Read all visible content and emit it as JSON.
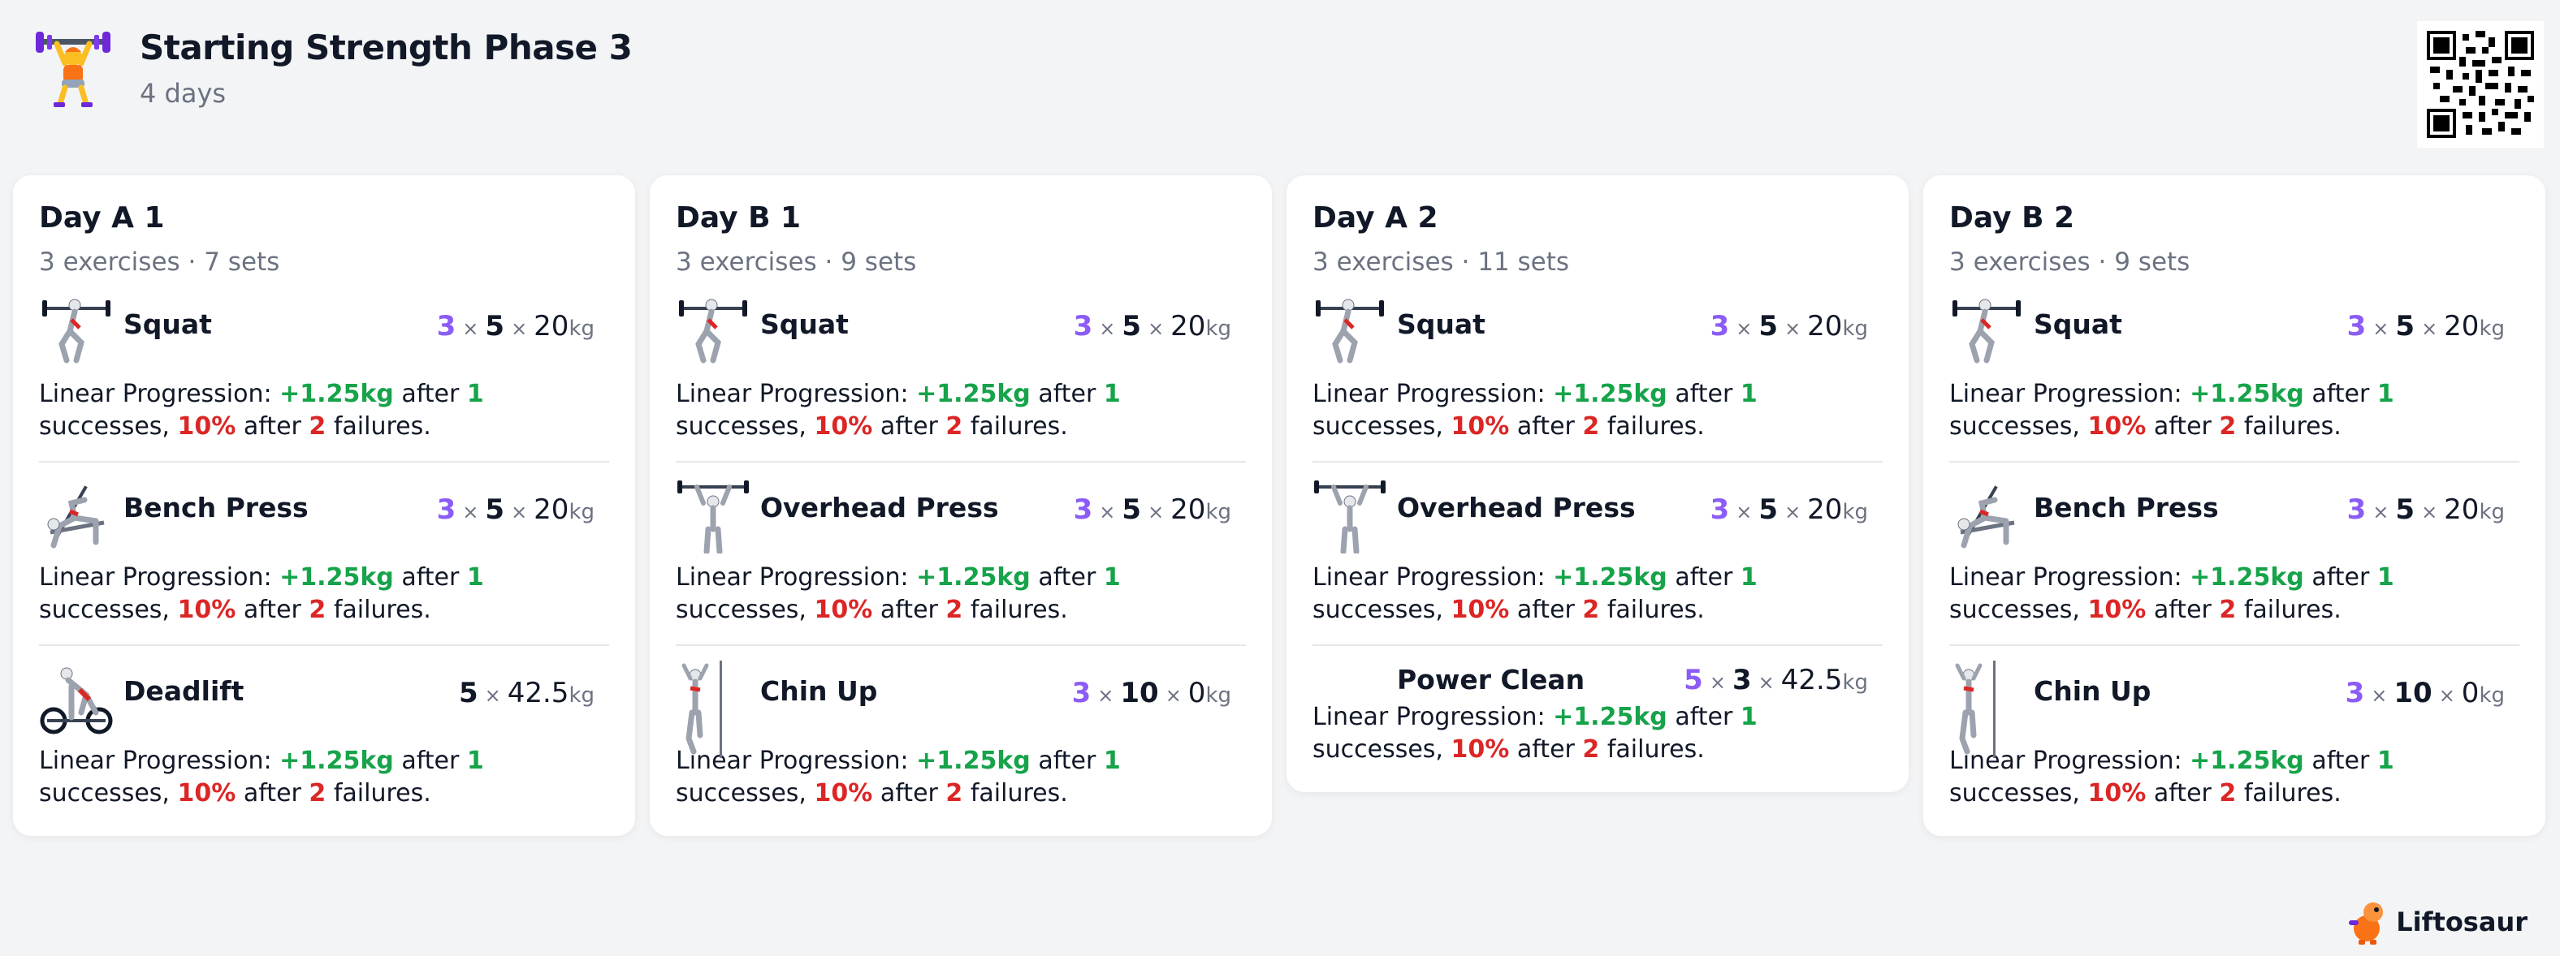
{
  "header": {
    "title": "Starting Strength Phase 3",
    "subtitle": "4 days"
  },
  "days": [
    {
      "title": "Day A 1",
      "meta": "3 exercises · 7 sets",
      "exercises": [
        {
          "name": "Squat",
          "sets": "3",
          "reps": "5",
          "weight": "20",
          "unit": "kg",
          "icon": "squat-icon",
          "prog": {
            "label": "Linear Progression:",
            "inc": "+1.25kg",
            "after1": "after",
            "succ": "1",
            "succ_word": "successes,",
            "dec": "10%",
            "after2": "after",
            "fail": "2",
            "fail_word": "failures."
          }
        },
        {
          "name": "Bench Press",
          "sets": "3",
          "reps": "5",
          "weight": "20",
          "unit": "kg",
          "icon": "bench-press-icon",
          "prog": {
            "label": "Linear Progression:",
            "inc": "+1.25kg",
            "after1": "after",
            "succ": "1",
            "succ_word": "successes,",
            "dec": "10%",
            "after2": "after",
            "fail": "2",
            "fail_word": "failures."
          }
        },
        {
          "name": "Deadlift",
          "sets": "",
          "reps": "5",
          "weight": "42.5",
          "unit": "kg",
          "icon": "deadlift-icon",
          "prog": {
            "label": "Linear Progression:",
            "inc": "+1.25kg",
            "after1": "after",
            "succ": "1",
            "succ_word": "successes,",
            "dec": "10%",
            "after2": "after",
            "fail": "2",
            "fail_word": "failures."
          }
        }
      ]
    },
    {
      "title": "Day B 1",
      "meta": "3 exercises · 9 sets",
      "exercises": [
        {
          "name": "Squat",
          "sets": "3",
          "reps": "5",
          "weight": "20",
          "unit": "kg",
          "icon": "squat-icon",
          "prog": {
            "label": "Linear Progression:",
            "inc": "+1.25kg",
            "after1": "after",
            "succ": "1",
            "succ_word": "successes,",
            "dec": "10%",
            "after2": "after",
            "fail": "2",
            "fail_word": "failures."
          }
        },
        {
          "name": "Overhead Press",
          "sets": "3",
          "reps": "5",
          "weight": "20",
          "unit": "kg",
          "icon": "overhead-press-icon",
          "prog": {
            "label": "Linear Progression:",
            "inc": "+1.25kg",
            "after1": "after",
            "succ": "1",
            "succ_word": "successes,",
            "dec": "10%",
            "after2": "after",
            "fail": "2",
            "fail_word": "failures."
          }
        },
        {
          "name": "Chin Up",
          "sets": "3",
          "reps": "10",
          "weight": "0",
          "unit": "kg",
          "icon": "chin-up-icon",
          "prog": {
            "label": "Linear Progression:",
            "inc": "+1.25kg",
            "after1": "after",
            "succ": "1",
            "succ_word": "successes,",
            "dec": "10%",
            "after2": "after",
            "fail": "2",
            "fail_word": "failures."
          }
        }
      ]
    },
    {
      "title": "Day A 2",
      "meta": "3 exercises · 11 sets",
      "exercises": [
        {
          "name": "Squat",
          "sets": "3",
          "reps": "5",
          "weight": "20",
          "unit": "kg",
          "icon": "squat-icon",
          "prog": {
            "label": "Linear Progression:",
            "inc": "+1.25kg",
            "after1": "after",
            "succ": "1",
            "succ_word": "successes,",
            "dec": "10%",
            "after2": "after",
            "fail": "2",
            "fail_word": "failures."
          }
        },
        {
          "name": "Overhead Press",
          "sets": "3",
          "reps": "5",
          "weight": "20",
          "unit": "kg",
          "icon": "overhead-press-icon",
          "prog": {
            "label": "Linear Progression:",
            "inc": "+1.25kg",
            "after1": "after",
            "succ": "1",
            "succ_word": "successes,",
            "dec": "10%",
            "after2": "after",
            "fail": "2",
            "fail_word": "failures."
          }
        },
        {
          "name": "Power Clean",
          "sets": "5",
          "reps": "3",
          "weight": "42.5",
          "unit": "kg",
          "icon": "",
          "prog": {
            "label": "Linear Progression:",
            "inc": "+1.25kg",
            "after1": "after",
            "succ": "1",
            "succ_word": "successes,",
            "dec": "10%",
            "after2": "after",
            "fail": "2",
            "fail_word": "failures."
          }
        }
      ]
    },
    {
      "title": "Day B 2",
      "meta": "3 exercises · 9 sets",
      "exercises": [
        {
          "name": "Squat",
          "sets": "3",
          "reps": "5",
          "weight": "20",
          "unit": "kg",
          "icon": "squat-icon",
          "prog": {
            "label": "Linear Progression:",
            "inc": "+1.25kg",
            "after1": "after",
            "succ": "1",
            "succ_word": "successes,",
            "dec": "10%",
            "after2": "after",
            "fail": "2",
            "fail_word": "failures."
          }
        },
        {
          "name": "Bench Press",
          "sets": "3",
          "reps": "5",
          "weight": "20",
          "unit": "kg",
          "icon": "bench-press-icon",
          "prog": {
            "label": "Linear Progression:",
            "inc": "+1.25kg",
            "after1": "after",
            "succ": "1",
            "succ_word": "successes,",
            "dec": "10%",
            "after2": "after",
            "fail": "2",
            "fail_word": "failures."
          }
        },
        {
          "name": "Chin Up",
          "sets": "3",
          "reps": "10",
          "weight": "0",
          "unit": "kg",
          "icon": "chin-up-icon",
          "prog": {
            "label": "Linear Progression:",
            "inc": "+1.25kg",
            "after1": "after",
            "succ": "1",
            "succ_word": "successes,",
            "dec": "10%",
            "after2": "after",
            "fail": "2",
            "fail_word": "failures."
          }
        }
      ]
    }
  ],
  "brand": {
    "name": "Liftosaur"
  },
  "colors": {
    "sets": "#8b5cf6",
    "increase": "#16a34a",
    "decrease": "#dc2626",
    "muted": "#6b7280",
    "background": "#f3f4f6"
  },
  "icons": {
    "header": "weightlifter-icon",
    "qr": "qr-code-icon",
    "brand": "liftosaur-dino-icon"
  }
}
